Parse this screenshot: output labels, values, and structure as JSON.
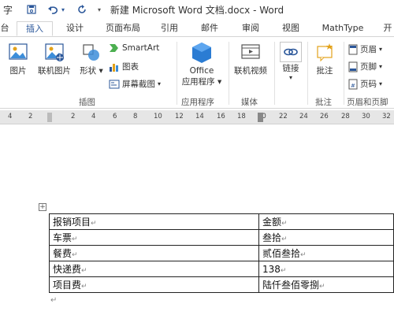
{
  "window": {
    "title": "新建 Microsoft Word 文档.docx - Word",
    "quick_access": [
      "字",
      "save",
      "undo",
      "redo"
    ]
  },
  "tabs": {
    "items": [
      {
        "label": "台"
      },
      {
        "label": "插入",
        "active": true
      },
      {
        "label": "设计"
      },
      {
        "label": "页面布局"
      },
      {
        "label": "引用"
      },
      {
        "label": "邮件"
      },
      {
        "label": "审阅"
      },
      {
        "label": "视图"
      },
      {
        "label": "MathType"
      },
      {
        "label": "开"
      }
    ]
  },
  "ribbon": {
    "illustrations": {
      "picture": "图片",
      "online_picture": "联机图片",
      "shapes": "形状",
      "smartart": "SmartArt",
      "chart": "图表",
      "screenshot": "屏幕截图",
      "group": "插图"
    },
    "apps": {
      "office_line1": "Office",
      "office_line2": "应用程序",
      "group": "应用程序"
    },
    "media": {
      "online_video": "联机视频",
      "group": "媒体"
    },
    "links": {
      "link": "链接"
    },
    "comments": {
      "comment": "批注",
      "group": "批注"
    },
    "header_footer": {
      "header": "页眉",
      "footer": "页脚",
      "page_number": "页码",
      "group": "页眉和页脚"
    }
  },
  "ruler": {
    "ticks": [
      "4",
      "2",
      "2",
      "4",
      "6",
      "8",
      "10",
      "12",
      "14",
      "16",
      "18",
      "20",
      "22",
      "24",
      "26",
      "28",
      "30",
      "32"
    ]
  },
  "document": {
    "table": {
      "rows": [
        [
          "报销项目",
          "金额"
        ],
        [
          "车票",
          "叁拾"
        ],
        [
          "餐费",
          "贰佰叁拾"
        ],
        [
          "快递费",
          "138"
        ],
        [
          "项目费",
          "陆仟叁佰零捌"
        ]
      ]
    }
  },
  "colors": {
    "accent": "#2b579a",
    "ruler": "#e6e6e6"
  }
}
